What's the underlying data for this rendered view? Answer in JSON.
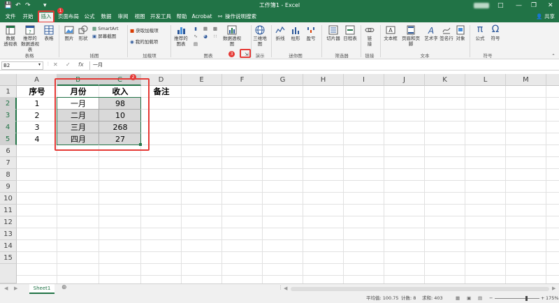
{
  "window": {
    "title": "工作簿1  -  Excel",
    "controls": [
      "restore-icon",
      "minimize-icon",
      "maximize-icon",
      "close-icon"
    ]
  },
  "tabs": [
    "文件",
    "开始",
    "插入",
    "页面布局",
    "公式",
    "数据",
    "审阅",
    "视图",
    "开发工具",
    "帮助",
    "Acrobat"
  ],
  "active_tab": "插入",
  "tell_me": "操作说明搜索",
  "share": "共享",
  "ribbon": {
    "groups": [
      {
        "label": "表格",
        "buttons": [
          "数据\n透视表",
          "推荐的\n数据透视表",
          "表格"
        ]
      },
      {
        "label": "插图",
        "buttons": [
          "图片",
          "形状",
          "SmartArt",
          "屏幕截图"
        ]
      },
      {
        "label": "加载项",
        "buttons": [
          "获取加载项",
          "我的加载项"
        ]
      },
      {
        "label": "图表",
        "buttons": [
          "推荐的\n图表",
          "数据透视图"
        ]
      },
      {
        "label": "演示",
        "buttons": [
          "三维地\n图"
        ]
      },
      {
        "label": "迷你图",
        "buttons": [
          "折线",
          "柱形",
          "盈亏"
        ]
      },
      {
        "label": "筛选器",
        "buttons": [
          "切片器",
          "日程表"
        ]
      },
      {
        "label": "链接",
        "buttons": [
          "链\n接"
        ]
      },
      {
        "label": "文本",
        "buttons": [
          "文本框",
          "页眉和页脚",
          "艺术字",
          "签名行",
          "对象"
        ]
      },
      {
        "label": "符号",
        "buttons": [
          "公式",
          "符号"
        ]
      }
    ]
  },
  "formula_bar": {
    "name_box": "B2",
    "fx": "fx",
    "value": "一月"
  },
  "columns": [
    "A",
    "B",
    "C",
    "D",
    "E",
    "F",
    "G",
    "H",
    "I",
    "J",
    "K",
    "L",
    "M"
  ],
  "rows": [
    "1",
    "2",
    "3",
    "4",
    "5",
    "6",
    "7",
    "8",
    "9",
    "10",
    "11",
    "12",
    "13",
    "14",
    "15"
  ],
  "table": {
    "header": [
      "序号",
      "月份",
      "收入",
      "备注"
    ],
    "rows": [
      [
        "1",
        "一月",
        "98"
      ],
      [
        "2",
        "二月",
        "10"
      ],
      [
        "3",
        "三月",
        "268"
      ],
      [
        "4",
        "四月",
        "27"
      ]
    ]
  },
  "sheet_tab": "Sheet1",
  "status": {
    "average": "平均值: 100.75",
    "count": "计数: 8",
    "sum": "求和: 403",
    "zoom": "175%"
  },
  "annotations": [
    "1",
    "2",
    "3"
  ],
  "colors": {
    "excel_green": "#217346",
    "highlight_red": "#e53935",
    "selection_fill": "#d9d9d9"
  }
}
